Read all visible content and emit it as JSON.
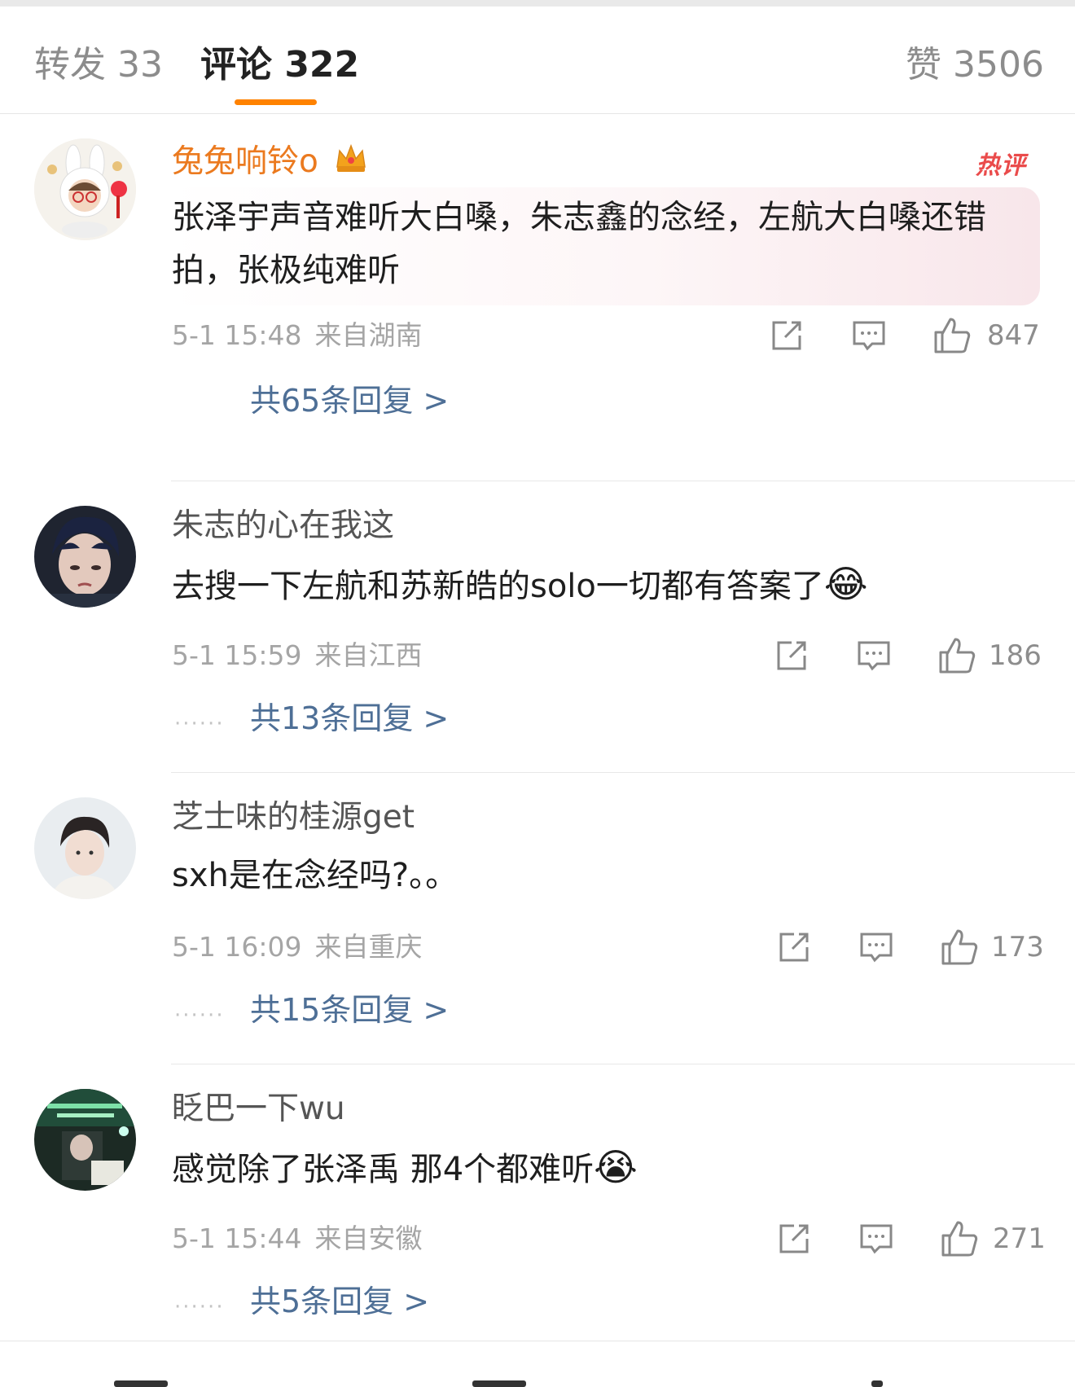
{
  "tabs": {
    "repost": "转发 33",
    "comments": "评论 322",
    "likes": "赞 3506"
  },
  "colors": {
    "accent": "#ff8200",
    "link": "#4e6f96",
    "hot_badge": "#ea4b4b",
    "hot_name": "#eb7a1f"
  },
  "comments": [
    {
      "username": "兔兔响铃o",
      "badge": "热评",
      "text": "张泽宇声音难听大白嗓，朱志鑫的念经，左航大白嗓还错拍，张极纯难听",
      "date": "5-1 15:48",
      "location": "来自湖南",
      "likes": "847",
      "replies": "共65条回复 >"
    },
    {
      "username": "朱志的心在我这",
      "text": "去搜一下左航和苏新皓的solo一切都有答案了",
      "emoji": "😂",
      "date": "5-1 15:59",
      "location": "来自江西",
      "likes": "186",
      "replies": "共13条回复 >"
    },
    {
      "username": "芝士味的桂源get",
      "text": "sxh是在念经吗?。。",
      "date": "5-1 16:09",
      "location": "来自重庆",
      "likes": "173",
      "replies": "共15条回复 >"
    },
    {
      "username": "眨巴一下wu",
      "text": "感觉除了张泽禹 那4个都难听",
      "emoji": "😭",
      "date": "5-1 15:44",
      "location": "来自安徽",
      "likes": "271",
      "replies": "共5条回复 >"
    }
  ],
  "icons": [
    "share-icon",
    "comment-icon",
    "like-icon",
    "crown-icon"
  ]
}
